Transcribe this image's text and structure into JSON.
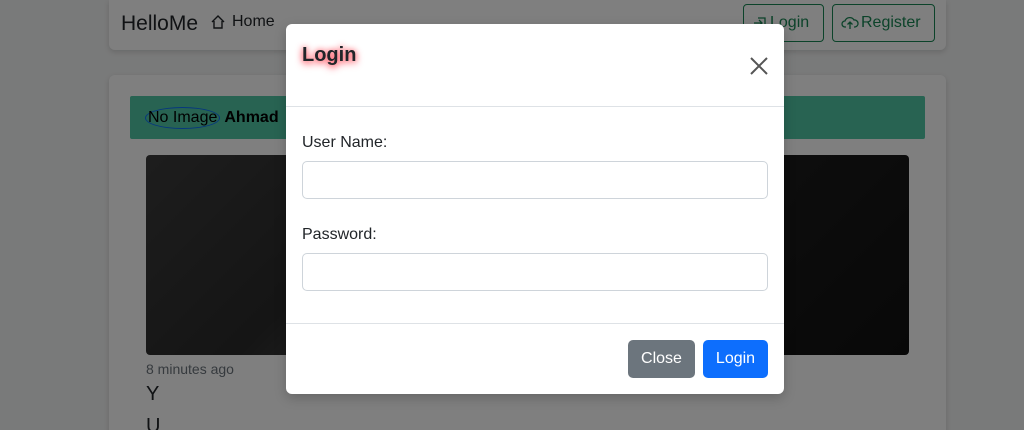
{
  "navbar": {
    "brand": "HelloMe",
    "home_label": "Home",
    "login_label": "Login",
    "register_label": "Register"
  },
  "post": {
    "avatar_alt": "No Image",
    "author": "Ahmad",
    "time": "8 minutes ago",
    "line1": "Y",
    "line2": "U"
  },
  "modal": {
    "title": "Login",
    "username_label": "User Name:",
    "username_value": "",
    "password_label": "Password:",
    "password_value": "",
    "close_button": "Close",
    "login_button": "Login"
  },
  "colors": {
    "accent_green": "#198754",
    "header_bg": "#50c6a4",
    "primary": "#0d6efd",
    "secondary": "#6c757d"
  }
}
